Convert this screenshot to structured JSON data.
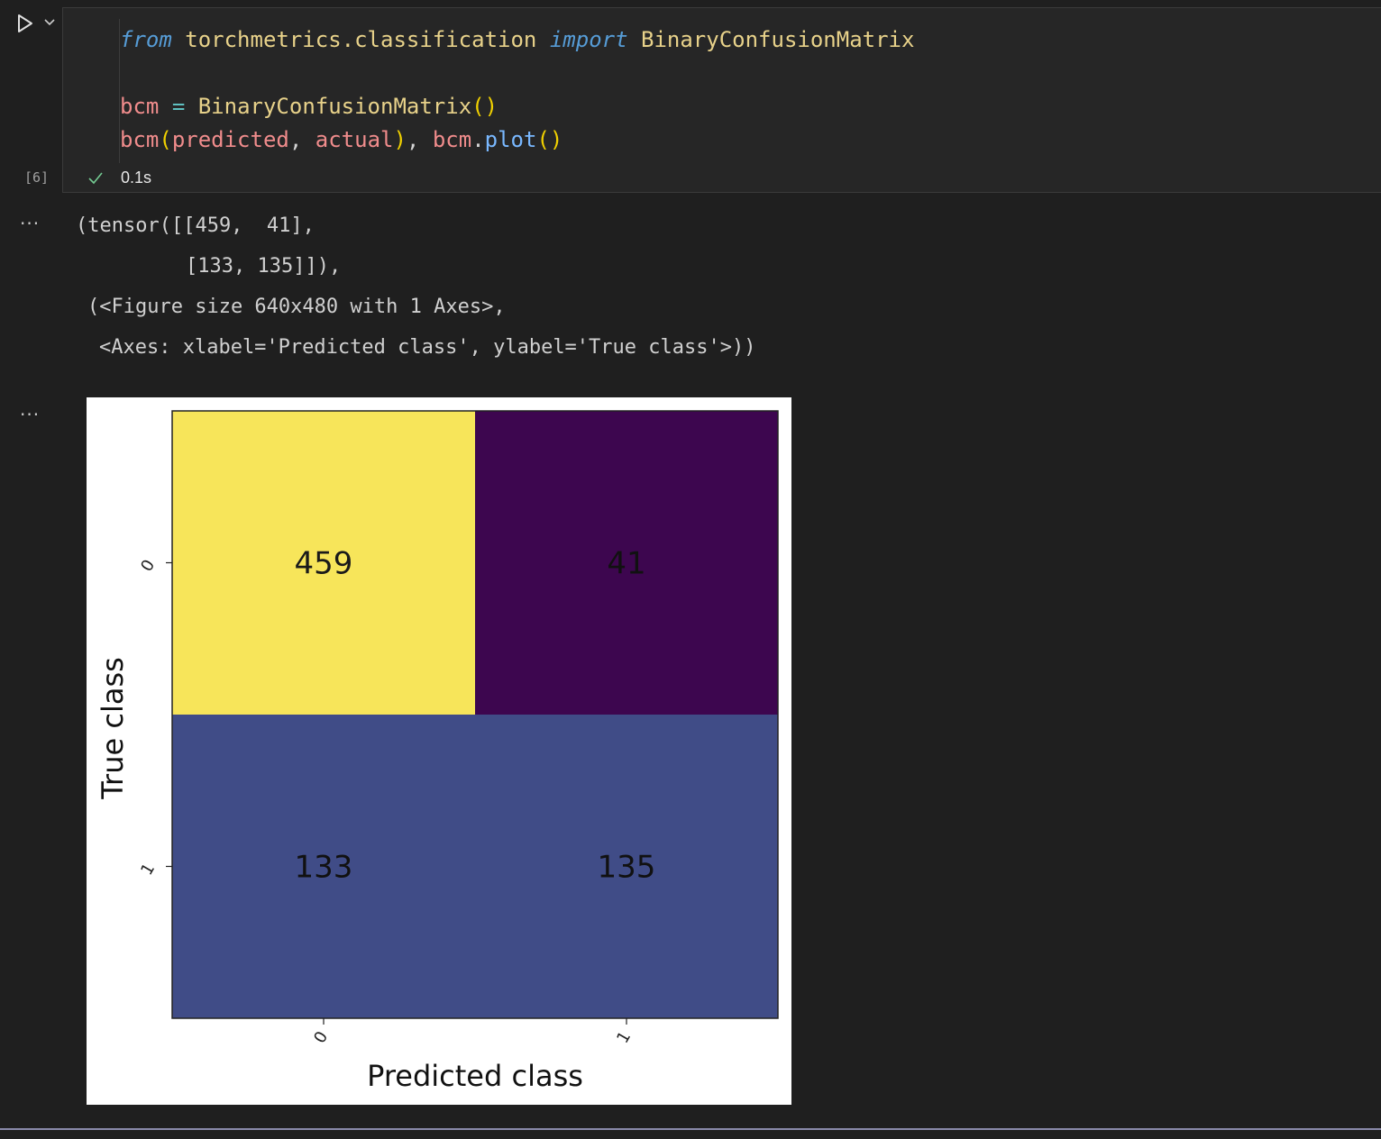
{
  "cell": {
    "code_lines": [
      [
        {
          "t": "from",
          "c": "kw"
        },
        {
          "t": " ",
          "c": "plain"
        },
        {
          "t": "torchmetrics.classification",
          "c": "mod"
        },
        {
          "t": " ",
          "c": "plain"
        },
        {
          "t": "import",
          "c": "kw"
        },
        {
          "t": " ",
          "c": "plain"
        },
        {
          "t": "BinaryConfusionMatrix",
          "c": "cls"
        }
      ],
      [],
      [
        {
          "t": "bcm",
          "c": "var"
        },
        {
          "t": " ",
          "c": "plain"
        },
        {
          "t": "=",
          "c": "op"
        },
        {
          "t": " ",
          "c": "plain"
        },
        {
          "t": "BinaryConfusionMatrix",
          "c": "cls"
        },
        {
          "t": "()",
          "c": "paren"
        }
      ],
      [
        {
          "t": "bcm",
          "c": "var"
        },
        {
          "t": "(",
          "c": "paren"
        },
        {
          "t": "predicted",
          "c": "var"
        },
        {
          "t": ", ",
          "c": "plain"
        },
        {
          "t": "actual",
          "c": "var"
        },
        {
          "t": ")",
          "c": "paren"
        },
        {
          "t": ", ",
          "c": "plain"
        },
        {
          "t": "bcm",
          "c": "var"
        },
        {
          "t": ".",
          "c": "plain"
        },
        {
          "t": "plot",
          "c": "fn"
        },
        {
          "t": "()",
          "c": "paren"
        }
      ]
    ],
    "execution_count": "[6]",
    "duration": "0.1s",
    "status_icon": "check-icon",
    "status_color": "#73c991"
  },
  "output": {
    "more_label": "...",
    "text_lines": [
      "(tensor([[459,  41],",
      "[133, 135]]),",
      "(<Figure size 640x480 with 1 Axes>,",
      "<Axes: xlabel='Predicted class', ylabel='True class'>))"
    ]
  },
  "chart_data": {
    "type": "heatmap",
    "title": "",
    "xlabel": "Predicted class",
    "ylabel": "True class",
    "x_ticks": [
      "0",
      "1"
    ],
    "y_ticks": [
      "0",
      "1"
    ],
    "matrix": [
      [
        459,
        41
      ],
      [
        133,
        135
      ]
    ],
    "colormap": "viridis",
    "cell_colors": [
      [
        "#f7e55a",
        "#3d064f"
      ],
      [
        "#404c87",
        "#404c87"
      ]
    ],
    "grid": false,
    "legend": "none"
  }
}
